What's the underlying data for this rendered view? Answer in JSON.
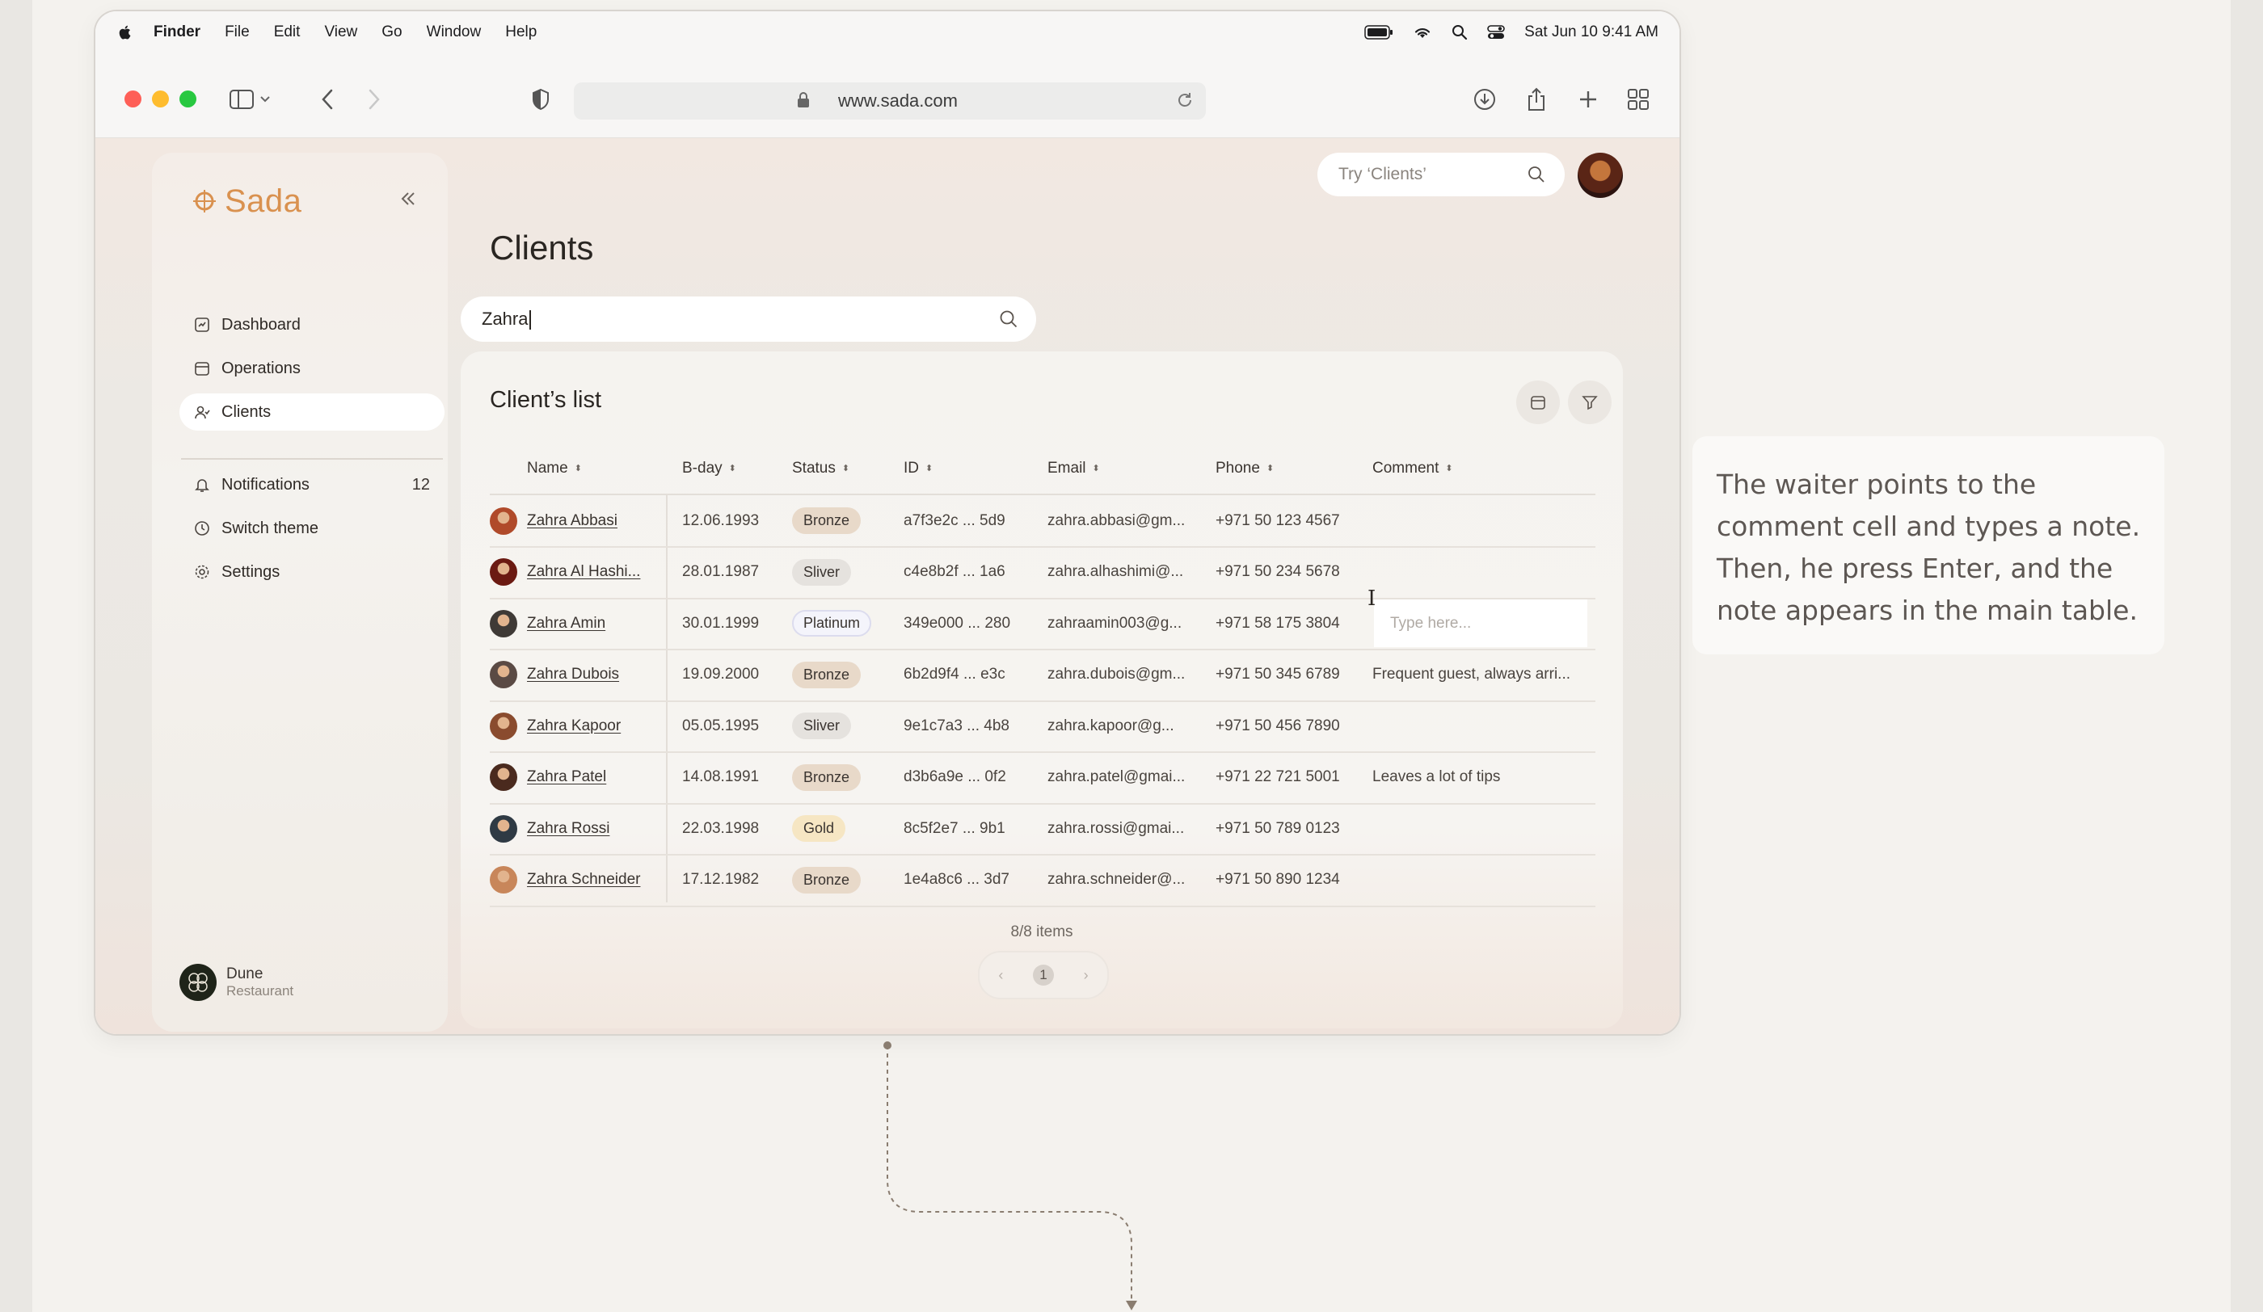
{
  "menubar": {
    "app_name": "Finder",
    "menus": [
      "File",
      "Edit",
      "View",
      "Go",
      "Window",
      "Help"
    ],
    "datetime": "Sat Jun 10  9:41 AM"
  },
  "browser": {
    "url": "www.sada.com"
  },
  "brand": {
    "name": "Sada",
    "accent": "#d9914f"
  },
  "sidebar": {
    "items": [
      {
        "label": "Dashboard",
        "icon": "dashboard-icon"
      },
      {
        "label": "Operations",
        "icon": "calendar-icon"
      },
      {
        "label": "Clients",
        "icon": "users-icon",
        "active": true
      },
      {
        "label": "Notifications",
        "icon": "bell-icon",
        "badge": "12"
      },
      {
        "label": "Switch theme",
        "icon": "clock-icon"
      },
      {
        "label": "Settings",
        "icon": "gear-icon"
      }
    ],
    "org": {
      "name": "Dune",
      "subtitle": "Restaurant"
    }
  },
  "header": {
    "search_placeholder": "Try ‘Clients’"
  },
  "page": {
    "title": "Clients",
    "search_value": "Zahra"
  },
  "table": {
    "title": "Client’s list",
    "columns": [
      "Name",
      "B-day",
      "Status",
      "ID",
      "Email",
      "Phone",
      "Comment"
    ],
    "rows": [
      {
        "name": "Zahra Abbasi",
        "bday": "12.06.1993",
        "status": "Bronze",
        "id": "a7f3e2c ... 5d9",
        "email": "zahra.abbasi@gm...",
        "phone": "+971 50 123 4567",
        "comment": ""
      },
      {
        "name": "Zahra Al Hashi...",
        "bday": "28.01.1987",
        "status": "Sliver",
        "id": "c4e8b2f ... 1a6",
        "email": "zahra.alhashimi@...",
        "phone": "+971 50 234 5678",
        "comment": ""
      },
      {
        "name": "Zahra Amin",
        "bday": "30.01.1999",
        "status": "Platinum",
        "id": "349e000 ... 280",
        "email": "zahraamin003@g...",
        "phone": "+971 58 175 3804",
        "comment": "",
        "comment_placeholder": "Type here..."
      },
      {
        "name": "Zahra Dubois",
        "bday": "19.09.2000",
        "status": "Bronze",
        "id": "6b2d9f4 ... e3c",
        "email": "zahra.dubois@gm...",
        "phone": "+971 50 345 6789",
        "comment": "Frequent guest, always arri..."
      },
      {
        "name": "Zahra Kapoor",
        "bday": "05.05.1995",
        "status": "Sliver",
        "id": "9e1c7a3 ... 4b8",
        "email": "zahra.kapoor@g...",
        "phone": "+971 50 456 7890",
        "comment": ""
      },
      {
        "name": "Zahra Patel",
        "bday": "14.08.1991",
        "status": "Bronze",
        "id": "d3b6a9e ... 0f2",
        "email": "zahra.patel@gmai...",
        "phone": "+971 22 721 5001",
        "comment": "Leaves a lot of tips"
      },
      {
        "name": "Zahra Rossi",
        "bday": "22.03.1998",
        "status": "Gold",
        "id": "8c5f2e7 ... 9b1",
        "email": "zahra.rossi@gmai...",
        "phone": "+971 50 789 0123",
        "comment": ""
      },
      {
        "name": "Zahra Schneider",
        "bday": "17.12.1982",
        "status": "Bronze",
        "id": "1e4a8c6 ... 3d7",
        "email": "zahra.schneider@...",
        "phone": "+971 50 890 1234",
        "comment": ""
      }
    ],
    "items_count": "8/8 items",
    "current_page": "1"
  },
  "annotation": {
    "text": "The waiter points to the comment cell and types a note. Then, he press Enter, and the note appears in the main table."
  }
}
